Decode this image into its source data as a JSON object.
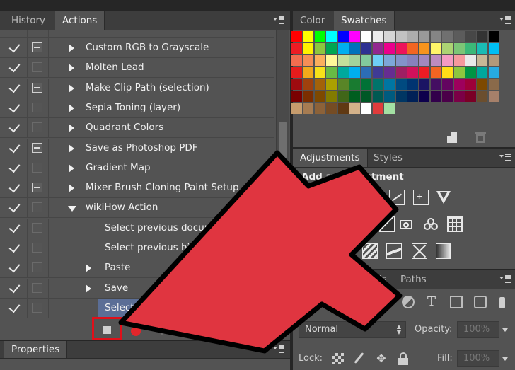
{
  "actions_panel": {
    "tabs": [
      "History",
      "Actions"
    ],
    "active_tab": "Actions",
    "rows": [
      {
        "label": "Custom RGB to Grayscale",
        "indent": 1,
        "expander": "collapsed",
        "dialog": "on",
        "checked": true
      },
      {
        "label": "Molten Lead",
        "indent": 1,
        "expander": "collapsed",
        "dialog": "off",
        "checked": true
      },
      {
        "label": "Make Clip Path (selection)",
        "indent": 1,
        "expander": "collapsed",
        "dialog": "on",
        "checked": true
      },
      {
        "label": "Sepia Toning (layer)",
        "indent": 1,
        "expander": "collapsed",
        "dialog": "off",
        "checked": true
      },
      {
        "label": "Quadrant Colors",
        "indent": 1,
        "expander": "collapsed",
        "dialog": "off",
        "checked": true
      },
      {
        "label": "Save as Photoshop PDF",
        "indent": 1,
        "expander": "collapsed",
        "dialog": "on",
        "checked": true
      },
      {
        "label": "Gradient Map",
        "indent": 1,
        "expander": "collapsed",
        "dialog": "off",
        "checked": true
      },
      {
        "label": "Mixer Brush Cloning Paint Setup",
        "indent": 1,
        "expander": "collapsed",
        "dialog": "on",
        "checked": true
      },
      {
        "label": "wikiHow Action",
        "indent": 1,
        "expander": "expanded",
        "dialog": "off",
        "checked": true
      },
      {
        "label": "Select previous docum",
        "indent": 3,
        "expander": "none",
        "dialog": "off",
        "checked": true
      },
      {
        "label": "Select previous his",
        "indent": 3,
        "expander": "none",
        "dialog": "off",
        "checked": true
      },
      {
        "label": "Paste",
        "indent": 2,
        "expander": "collapsed",
        "dialog": "off",
        "checked": true
      },
      {
        "label": "Save",
        "indent": 2,
        "expander": "collapsed",
        "dialog": "off",
        "checked": true
      },
      {
        "label": "Select",
        "indent": 3,
        "expander": "none",
        "dialog": "off",
        "checked": true,
        "selected": true
      }
    ],
    "toolbar": [
      "stop-recording",
      "record",
      "play",
      "new-set",
      "new-action",
      "delete"
    ]
  },
  "properties_panel": {
    "tab": "Properties"
  },
  "color_panel": {
    "tabs": [
      "Color",
      "Swatches"
    ],
    "active_tab": "Swatches",
    "swatch_rows": [
      [
        "#ff0000",
        "#ffff00",
        "#00ff00",
        "#00ffff",
        "#0000ff",
        "#ff00ff",
        "#ffffff",
        "#ebebeb",
        "#d6d6d6",
        "#c2c2c2",
        "#adadad",
        "#999999",
        "#858585",
        "#707070",
        "#5c5c5c",
        "#474747",
        "#333333",
        "#000000"
      ],
      [
        "#ed1c24",
        "#fff200",
        "#8dc63f",
        "#00a651",
        "#00aeef",
        "#0072bc",
        "#2e3192",
        "#92278f",
        "#ec008c",
        "#ed145b",
        "#f26522",
        "#f7941d",
        "#fff568",
        "#acd373",
        "#7cc576",
        "#3bb878",
        "#1abbb4",
        "#00bff3"
      ],
      [
        "#f26c4f",
        "#f68e56",
        "#fbaf5d",
        "#fff799",
        "#c4df9b",
        "#a3d39c",
        "#82ca9c",
        "#6ecff6",
        "#7da7d9",
        "#8393ca",
        "#8781bd",
        "#a187be",
        "#bd8cbf",
        "#f49ac2",
        "#f6989d",
        "#e9e9e9",
        "#c8b696",
        "#b2997a"
      ],
      [
        "#e51c1c",
        "#f2a91b",
        "#f7e11a",
        "#68bb45",
        "#00a99d",
        "#00aeef",
        "#2c6db5",
        "#3f3b95",
        "#662d91",
        "#9e1f63",
        "#d1115b",
        "#ed1c24",
        "#f26522",
        "#ffde17",
        "#8dc63f",
        "#009444",
        "#00a79d",
        "#27aae1"
      ],
      [
        "#9e0b0f",
        "#a0410d",
        "#a36209",
        "#aba000",
        "#598527",
        "#197b30",
        "#007236",
        "#00746b",
        "#0076a3",
        "#004a80",
        "#003471",
        "#1b1464",
        "#440e62",
        "#630460",
        "#9e005d",
        "#9e0039",
        "#7d4900",
        "#8a6a4a"
      ],
      [
        "#790000",
        "#7b2e00",
        "#7d4900",
        "#827b00",
        "#406618",
        "#005e20",
        "#005826",
        "#005952",
        "#005b7f",
        "#003663",
        "#002157",
        "#0d004c",
        "#32004b",
        "#4b0049",
        "#7b0046",
        "#7a0026",
        "#6b4e2e",
        "#a6806a"
      ],
      [
        "#c69c6d",
        "#a67c52",
        "#8c6239",
        "#754c24",
        "#603913",
        "#d4b28a",
        "#ffffff",
        "#e03c3c",
        "#a3e0a3"
      ]
    ],
    "actions": [
      "new-swatch",
      "delete-swatch"
    ]
  },
  "adjustments_panel": {
    "tabs": [
      "Adjustments",
      "Styles"
    ],
    "active_tab": "Adjustments",
    "heading": "Add an adjustment",
    "icon_rows": [
      [
        "brightness-contrast-icon",
        "levels-icon",
        "curves-icon",
        "exposure-icon",
        "vibrance-icon"
      ],
      [
        "hue-saturation-icon",
        "color-balance-icon",
        "black-white-icon",
        "photo-filter-icon",
        "channel-mixer-icon",
        "color-lookup-icon"
      ],
      [
        "invert-icon",
        "posterize-icon",
        "threshold-icon",
        "selective-color-icon",
        "gradient-map-icon"
      ]
    ]
  },
  "layers_panel": {
    "tabs": [
      "Layers",
      "Channels",
      "Paths"
    ],
    "visible_tabs": [
      "ers",
      "Channels",
      "Paths"
    ],
    "active_tab": "Layers",
    "blend_mode": "Normal",
    "opacity_label": "Opacity:",
    "opacity_value": "100%",
    "lock_label": "Lock:",
    "fill_label": "Fill:",
    "fill_value": "100%"
  },
  "overlay": {
    "arrow_color": "#e03540",
    "highlight_color": "#e0101a"
  }
}
